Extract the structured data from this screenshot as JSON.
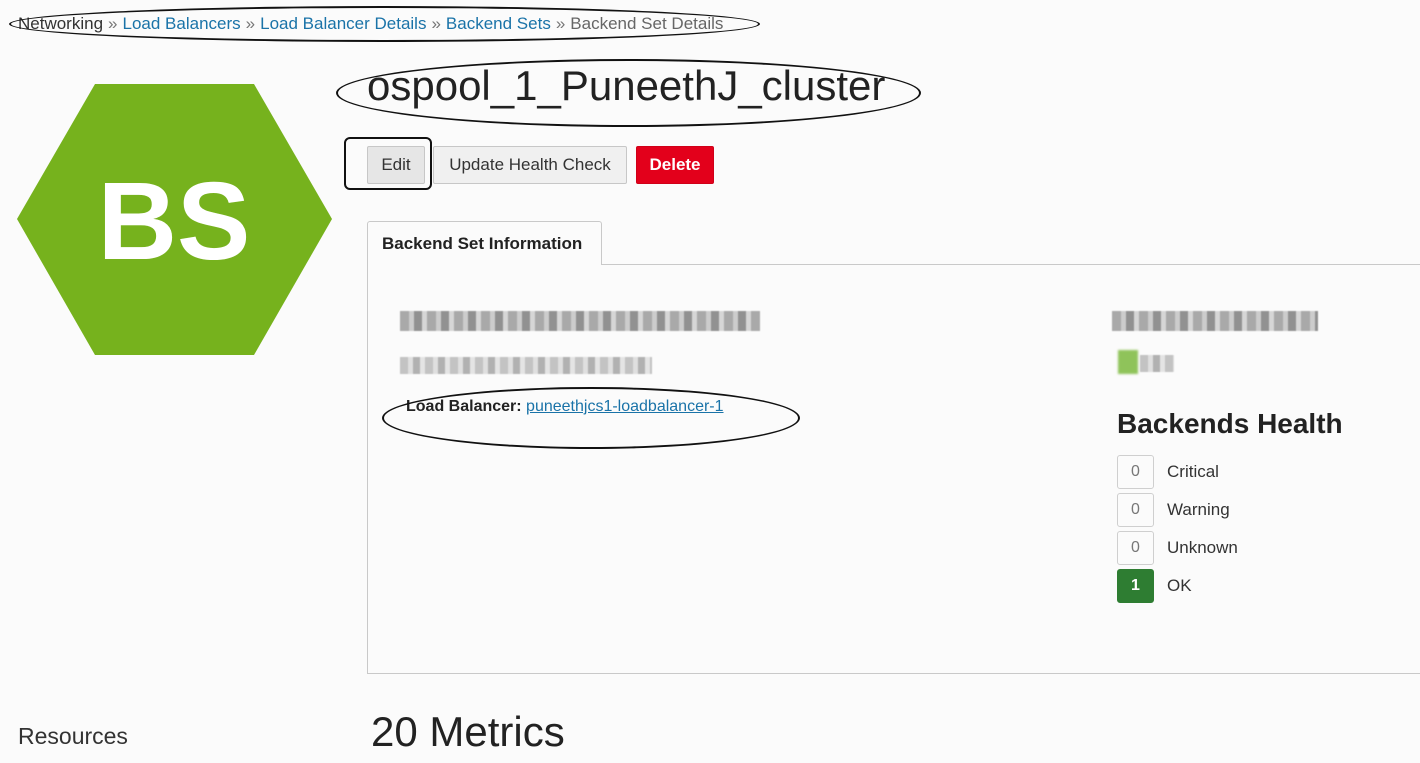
{
  "breadcrumb": {
    "items": [
      "Networking",
      "Load Balancers",
      "Load Balancer Details",
      "Backend Sets",
      "Backend Set Details"
    ],
    "separator": "»"
  },
  "logo": {
    "text": "BS",
    "color": "#76b21d"
  },
  "page_title": "ospool_1_PuneethJ_cluster",
  "actions": {
    "edit": "Edit",
    "update_health_check": "Update Health Check",
    "delete": "Delete"
  },
  "tabs": [
    {
      "label": "Backend Set Information"
    }
  ],
  "info": {
    "load_balancer_label": "Load Balancer:",
    "load_balancer_link": "puneethjcs1-loadbalancer-1"
  },
  "backends_health": {
    "title": "Backends Health",
    "rows": [
      {
        "count": "0",
        "label": "Critical"
      },
      {
        "count": "0",
        "label": "Warning"
      },
      {
        "count": "0",
        "label": "Unknown"
      },
      {
        "count": "1",
        "label": "OK"
      }
    ]
  },
  "sidebar": {
    "resources_label": "Resources"
  },
  "metrics": {
    "title": "20 Metrics"
  },
  "colors": {
    "link": "#1a73a8",
    "danger": "#e3001b",
    "ok": "#2e7d32"
  }
}
